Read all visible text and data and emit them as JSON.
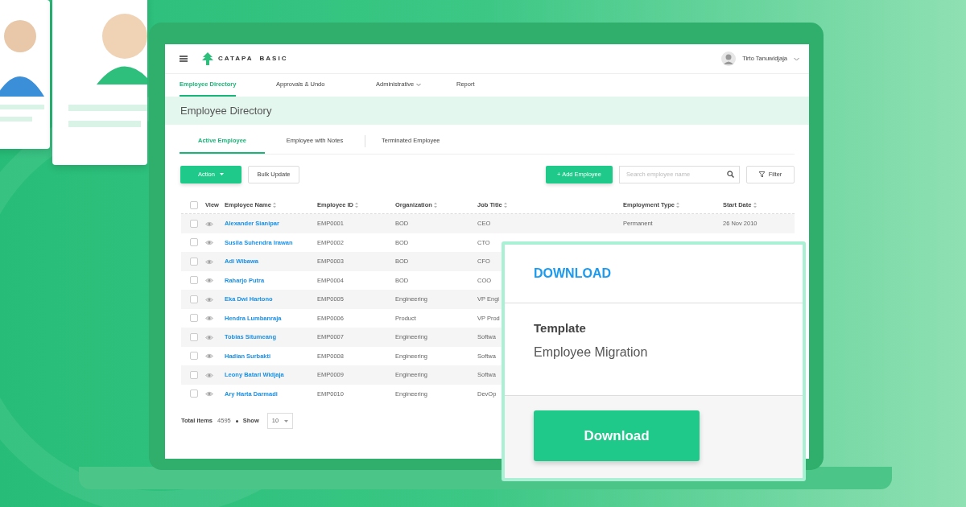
{
  "app": {
    "brand": "CATAPA",
    "edition": "BASIC",
    "user": "Tirto Tanuwidjaja"
  },
  "nav": [
    {
      "label": "Employee Directory",
      "selected": true,
      "dropdown": false
    },
    {
      "label": "Approvals & Undo",
      "selected": false,
      "dropdown": false
    },
    {
      "label": "Administrative",
      "selected": false,
      "dropdown": true
    },
    {
      "label": "Report",
      "selected": false,
      "dropdown": false
    }
  ],
  "page_title": "Employee Directory",
  "tabs": [
    {
      "label": "Active Employee",
      "selected": true
    },
    {
      "label": "Employee with Notes",
      "selected": false
    },
    {
      "label": "Terminated Employee",
      "selected": false
    }
  ],
  "toolbar": {
    "action": "Action",
    "bulk_update": "Bulk Update",
    "add": "+ Add Employee",
    "search_placeholder": "Search employee name",
    "filter": "Filter"
  },
  "table": {
    "select_all_checked": false,
    "columns": [
      {
        "label": "View",
        "sortable": false
      },
      {
        "label": "Employee Name",
        "sortable": true
      },
      {
        "label": "Employee ID",
        "sortable": true
      },
      {
        "label": "Organization",
        "sortable": true
      },
      {
        "label": "Job Title",
        "sortable": true
      },
      {
        "label": "Employment Type",
        "sortable": true
      },
      {
        "label": "Start Date",
        "sortable": true
      }
    ],
    "rows": [
      {
        "checked": false,
        "name": "Alexander Sianipar",
        "id": "EMP0001",
        "organization": "BOD",
        "job_title": "CEO",
        "employment_type": "Permanent",
        "start_date": "26 Nov 2010"
      },
      {
        "checked": false,
        "name": "Susila Suhendra Irawan",
        "id": "EMP0002",
        "organization": "BOD",
        "job_title": "CTO"
      },
      {
        "checked": false,
        "name": "Adi Wibawa",
        "id": "EMP0003",
        "organization": "BOD",
        "job_title": "CFO"
      },
      {
        "checked": false,
        "name": "Raharjo Putra",
        "id": "EMP0004",
        "organization": "BOD",
        "job_title": "COO"
      },
      {
        "checked": false,
        "name": "Eka Dwi Hartono",
        "id": "EMP0005",
        "organization": "Engineering",
        "job_title": "VP Engi"
      },
      {
        "checked": false,
        "name": "Hendra Lumbanraja",
        "id": "EMP0006",
        "organization": "Product",
        "job_title": "VP Prod"
      },
      {
        "checked": false,
        "name": "Tobias Situmeang",
        "id": "EMP0007",
        "organization": "Engineering",
        "job_title": "Softwa"
      },
      {
        "checked": false,
        "name": "Hadian Surbakti",
        "id": "EMP0008",
        "organization": "Engineering",
        "job_title": "Softwa"
      },
      {
        "checked": false,
        "name": "Leony Batari Widjaja",
        "id": "EMP0009",
        "organization": "Engineering",
        "job_title": "Softwa"
      },
      {
        "checked": false,
        "name": "Ary Harta Darmadi",
        "id": "EMP0010",
        "organization": "Engineering",
        "job_title": "DevOp"
      }
    ]
  },
  "footer": {
    "total_label": "Total items",
    "total": "4595",
    "show_label": "Show",
    "page_size": "10"
  },
  "download_card": {
    "heading": "DOWNLOAD",
    "label": "Template",
    "value": "Employee Migration",
    "button": "Download"
  }
}
